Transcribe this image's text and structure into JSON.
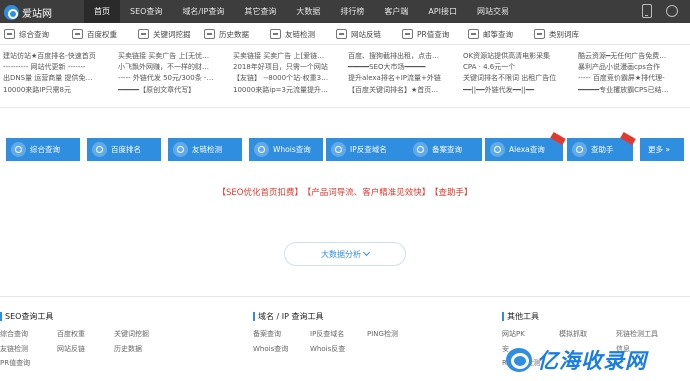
{
  "brand": {
    "name": "爱站网"
  },
  "nav": [
    "首页",
    "SEO查询",
    "域名/IP查询",
    "其它查询",
    "大数据",
    "排行榜",
    "客户端",
    "API接口",
    "网站交易"
  ],
  "tools": [
    "综合查询",
    "百度权重",
    "关键词挖掘",
    "历史数据",
    "友链检测",
    "网站反链",
    "PR值查询",
    "邮筝查询",
    "类别词库"
  ],
  "columns": [
    [
      "建站仿站★百度排名-快速首页",
      "---------- 网站代更新 -------",
      "出DNS量 运营商量 提供免…",
      "10000来路IP只需8元"
    ],
    [
      "买卖链接 买卖广告 上[无忧…",
      "小飞飘外网赚，不一样的财…",
      "----- 外链代发 50元/300条 -…",
      "━━━━━【原创文章代写】"
    ],
    [
      "买卖链接 买卖广告 上[爱链…",
      "2018年好项目，只需一个网站",
      "【友链】 --8000个站-权重3…",
      "10000来路ip=3元流量提升…"
    ],
    [
      "百度、搜狗截排出租，点击…",
      "━━━━━SEO大市场━━━━━",
      "提升alexa排名+IP流量+外链",
      "【百度关键词排名】★首页…"
    ],
    [
      "OK资源站提供高清电影采集",
      "CPA · 4.6元一个",
      "关键词排名不限词 出租广告位",
      "━━||━━外链代发━━||━━"
    ],
    [
      "酷云资源━无任何广告免费…",
      "暴利产品小说漫画cps合作",
      "----- 百度竞价霸屏★排代理-",
      "━━━━━专业攫放霸CPS已结…"
    ]
  ],
  "buttons": [
    {
      "label": "综合查询",
      "hot": false
    },
    {
      "label": "百度排名",
      "hot": false
    },
    {
      "label": "友链检测",
      "hot": false
    },
    {
      "label": "Whois查询",
      "hot": false
    },
    {
      "label": "IP反查域名",
      "hot": false
    },
    {
      "label": "备案查询",
      "hot": false
    },
    {
      "label": "Alexa查询",
      "hot": true
    },
    {
      "label": "查助手",
      "hot": true
    },
    {
      "label": "更多 »",
      "hot": false
    }
  ],
  "promo": [
    "【SEO优化首页扣费】",
    "【产品词导流、客户精准见效快】",
    "【查助手】"
  ],
  "big_button": "大数据分析",
  "footer": {
    "seo": {
      "title": "SEO查询工具",
      "items": [
        "综合查询",
        "百度权重",
        "关键词挖掘",
        "友链检测",
        "网站反链",
        "历史数据",
        "PR值查询"
      ]
    },
    "domain": {
      "title": "域名 / IP 查询工具",
      "items": [
        "备案查询",
        "IP反查域名",
        "PING检测",
        "Whois查询",
        "Whois反查"
      ]
    },
    "other": {
      "title": "其他工具",
      "items": [
        "网站PK",
        "模拟抓取",
        "死链检测工具",
        "安",
        "",
        "信息",
        "Robots检测"
      ]
    }
  },
  "watermark": "亿海收录网",
  "colors": {
    "accent": "#2f8ee0",
    "topbar": "#3d3d3d",
    "promo": "#e03a2f"
  }
}
